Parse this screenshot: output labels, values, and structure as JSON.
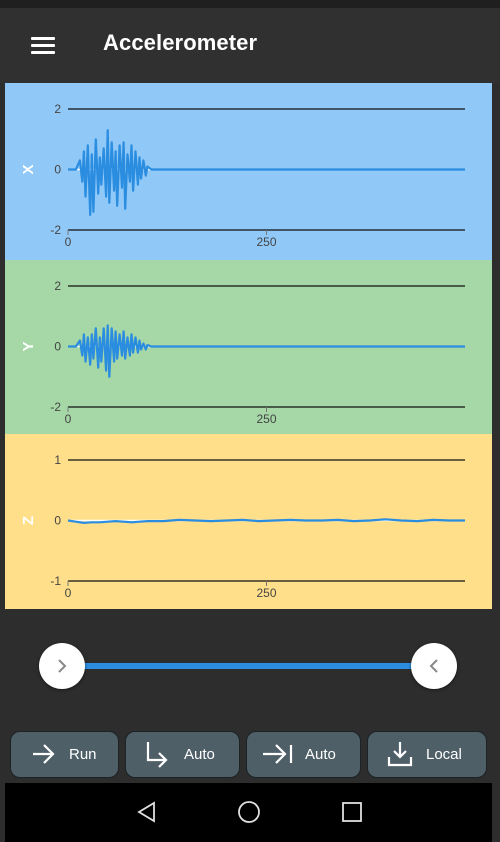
{
  "app": {
    "title": "Accelerometer"
  },
  "colors": {
    "x_panel": "#90c9f8",
    "y_panel": "#a5d7a7",
    "z_panel": "#ffdf89",
    "trace": "#2b8de0",
    "button": "#4f5f68"
  },
  "chart_data": [
    {
      "type": "line",
      "name": "X",
      "axis_label": "X",
      "ylim": [
        -2,
        2
      ],
      "y_ticks": [
        "2",
        "0",
        "-2"
      ],
      "xlim": [
        0,
        500
      ],
      "x_ticks": [
        "0",
        "250"
      ],
      "series": [
        {
          "x": [
            0,
            10,
            15,
            18,
            20,
            22,
            25,
            28,
            30,
            32,
            35,
            38,
            40,
            42,
            45,
            48,
            50,
            52,
            55,
            58,
            60,
            62,
            65,
            68,
            70,
            72,
            75,
            78,
            80,
            82,
            85,
            88,
            90,
            92,
            95,
            98,
            100,
            105,
            110,
            150,
            200,
            250,
            300,
            350,
            400,
            500
          ],
          "y": [
            0,
            0,
            0.3,
            -0.4,
            0.6,
            -0.9,
            0.8,
            -1.5,
            0.5,
            -1.4,
            1.0,
            -0.8,
            0.4,
            -0.5,
            0.7,
            -0.9,
            1.3,
            -1.1,
            0.9,
            -0.7,
            0.6,
            -1.2,
            0.8,
            -0.6,
            0.9,
            -1.3,
            0.5,
            -0.4,
            0.8,
            -0.7,
            0.6,
            -0.5,
            0.4,
            -0.3,
            0.3,
            -0.2,
            0.1,
            0,
            0,
            0,
            0,
            0,
            0,
            0,
            0,
            0
          ]
        }
      ]
    },
    {
      "type": "line",
      "name": "Y",
      "axis_label": "Y",
      "ylim": [
        -2,
        2
      ],
      "y_ticks": [
        "2",
        "0",
        "-2"
      ],
      "xlim": [
        0,
        500
      ],
      "x_ticks": [
        "0",
        "250"
      ],
      "series": [
        {
          "x": [
            0,
            10,
            15,
            18,
            20,
            22,
            25,
            28,
            30,
            32,
            35,
            38,
            40,
            42,
            45,
            48,
            50,
            52,
            55,
            58,
            60,
            62,
            65,
            68,
            70,
            72,
            75,
            78,
            80,
            82,
            85,
            88,
            90,
            92,
            95,
            98,
            100,
            105,
            110,
            150,
            200,
            250,
            300,
            350,
            400,
            500
          ],
          "y": [
            0,
            0,
            0.2,
            -0.3,
            0.4,
            -0.5,
            0.3,
            -0.6,
            0.4,
            -0.4,
            0.6,
            -0.7,
            0.3,
            -0.5,
            0.6,
            -0.8,
            0.7,
            -1.0,
            0.6,
            -0.5,
            0.5,
            -0.4,
            0.4,
            -0.3,
            0.5,
            -0.4,
            0.3,
            -0.3,
            0.4,
            -0.2,
            0.3,
            -0.2,
            0.2,
            -0.1,
            0.1,
            -0.1,
            0.05,
            0,
            0,
            0,
            0,
            0,
            0,
            0,
            0,
            0
          ]
        }
      ]
    },
    {
      "type": "line",
      "name": "Z",
      "axis_label": "Z",
      "ylim": [
        -1,
        1
      ],
      "y_ticks": [
        "1",
        "0",
        "-1"
      ],
      "xlim": [
        0,
        500
      ],
      "x_ticks": [
        "0",
        "250"
      ],
      "series": [
        {
          "x": [
            0,
            10,
            20,
            30,
            40,
            50,
            60,
            70,
            80,
            90,
            100,
            120,
            140,
            160,
            180,
            200,
            220,
            240,
            260,
            280,
            300,
            320,
            340,
            360,
            380,
            400,
            420,
            440,
            460,
            480,
            500
          ],
          "y": [
            0,
            -0.02,
            -0.04,
            -0.03,
            -0.03,
            -0.02,
            -0.01,
            -0.02,
            -0.03,
            -0.02,
            -0.01,
            -0.01,
            0.01,
            0.0,
            -0.01,
            0.0,
            0.01,
            -0.01,
            0.0,
            0.01,
            0.0,
            0.0,
            0.01,
            -0.01,
            0.0,
            0.02,
            0.0,
            -0.01,
            0.01,
            0.0,
            0.0
          ]
        }
      ]
    }
  ],
  "range": {
    "start": 0.0,
    "end": 1.0
  },
  "buttons": [
    {
      "label": "Run",
      "icon": "arrow-right-icon"
    },
    {
      "label": "Auto",
      "icon": "turn-right-icon"
    },
    {
      "label": "Auto",
      "icon": "arrow-to-bar-icon"
    },
    {
      "label": "Local",
      "icon": "download-icon"
    }
  ],
  "nav": [
    "back-icon",
    "home-icon",
    "recents-icon"
  ]
}
